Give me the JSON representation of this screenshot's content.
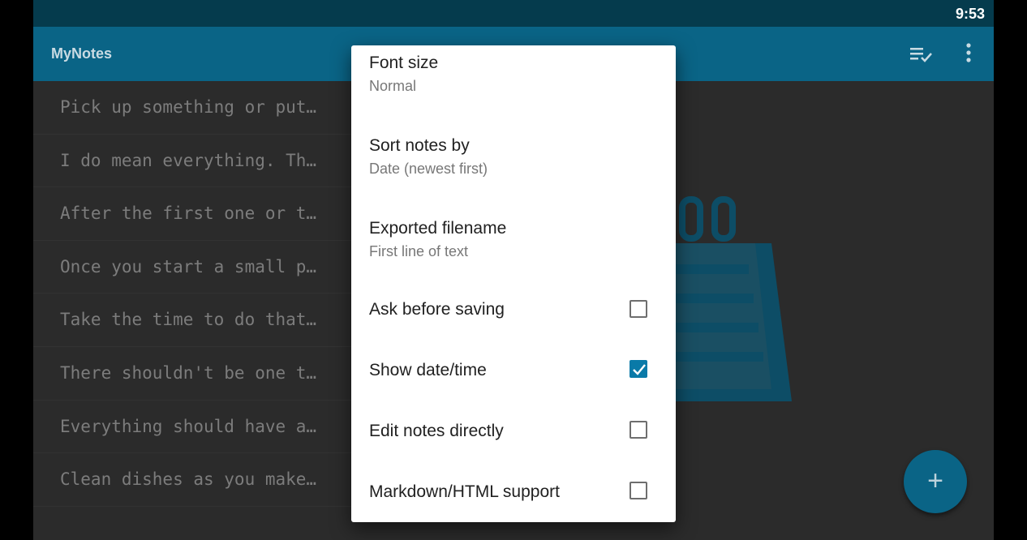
{
  "status_bar": {
    "time": "9:53"
  },
  "app_bar": {
    "title": "MyNotes",
    "icons": [
      "select-all-icon",
      "overflow-menu-icon"
    ]
  },
  "notes": [
    "Pick up something or put…",
    "I do mean everything. Th…",
    "After the first one or t…",
    "Once you start a small p…",
    "Take the time to do that…",
    "There shouldn't be one t…",
    "Everything should have a…",
    "Clean dishes as you make…"
  ],
  "fab": {
    "icon": "plus-icon",
    "label": "+"
  },
  "colors": {
    "primary": "#0a6486",
    "status_bar": "#053b4d",
    "accent": "#0a7aa8",
    "background": "#2b2b2b"
  },
  "settings_dialog": {
    "font_size": {
      "title": "Font size",
      "summary": "Normal"
    },
    "sort_notes": {
      "title": "Sort notes by",
      "summary": "Date (newest first)"
    },
    "exported_filename": {
      "title": "Exported filename",
      "summary": "First line of text"
    },
    "ask_before_saving": {
      "title": "Ask before saving",
      "checked": false
    },
    "show_date_time": {
      "title": "Show date/time",
      "checked": true
    },
    "edit_notes_directly": {
      "title": "Edit notes directly",
      "checked": false
    },
    "markdown_html": {
      "title": "Markdown/HTML support",
      "checked": false
    }
  }
}
